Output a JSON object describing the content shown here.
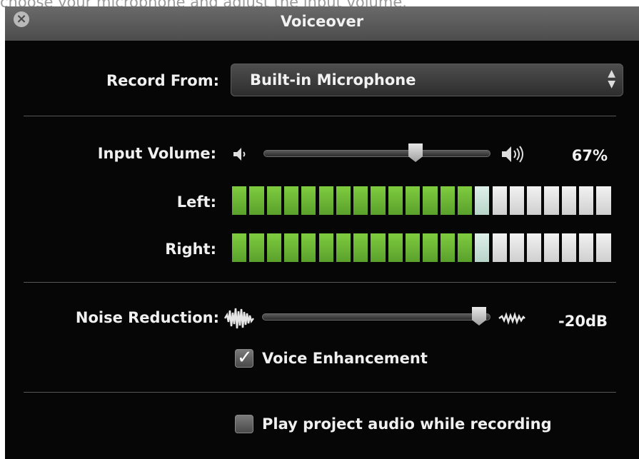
{
  "caption": "choose your microphone and adjust the input volume.",
  "window": {
    "title": "Voiceover",
    "close_icon": "close-icon"
  },
  "record_from": {
    "label": "Record From:",
    "selected": "Built-in Microphone"
  },
  "input_volume": {
    "label": "Input Volume:",
    "value_text": "67%",
    "level": 0.67
  },
  "meters": {
    "left": {
      "label": "Left:",
      "lit_segments": 14,
      "peak_segment": 15,
      "total_segments": 22
    },
    "right": {
      "label": "Right:",
      "lit_segments": 14,
      "peak_segment": 15,
      "total_segments": 22
    }
  },
  "noise_reduction": {
    "label": "Noise Reduction:",
    "value_text": "-20dB",
    "level": 0.95
  },
  "voice_enhancement": {
    "label": "Voice Enhancement",
    "checked": true
  },
  "play_audio": {
    "label": "Play project audio while recording",
    "checked": false
  },
  "colors": {
    "meter_on": "#6cb534",
    "meter_peak": "#cfe6dd",
    "meter_off": "#e2e2e2"
  }
}
